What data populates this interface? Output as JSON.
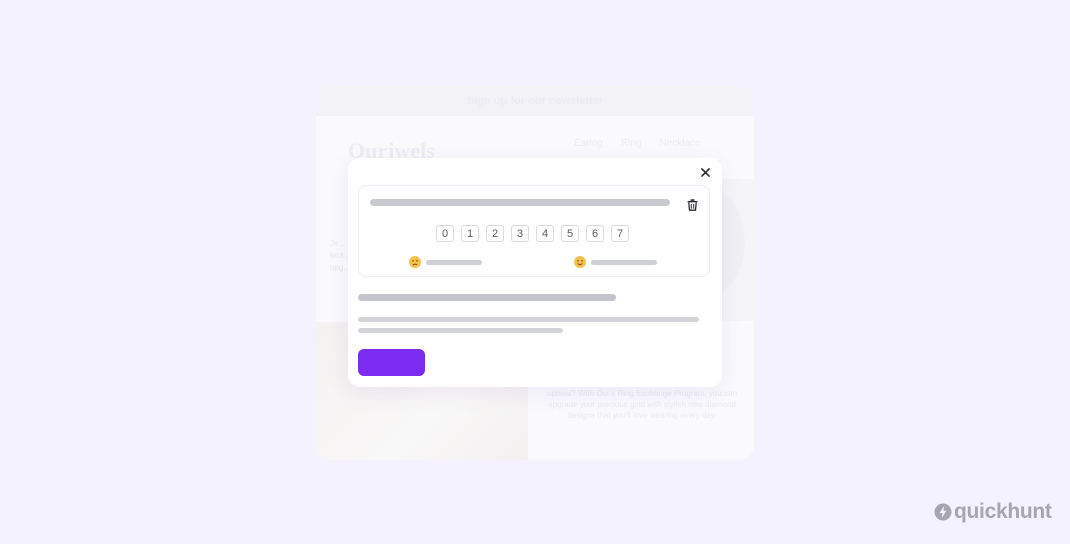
{
  "background_email": {
    "banner": "Sign up for our newsletter",
    "logo": "Ourjwels",
    "nav": [
      "Earing",
      "Ring",
      "Necklace"
    ],
    "side_text": "Je... lock... upg...",
    "copy": "upbeat? With Our's Ring Exchange Program, you can upgrade your precious gold with stylish new diamond designs that you'll love wearing every day."
  },
  "modal": {
    "close_icon": "close-icon",
    "question": {
      "trash_icon": "trash-icon",
      "scale": [
        "0",
        "1",
        "2",
        "3",
        "4",
        "5",
        "6",
        "7"
      ],
      "low_emoji": "sad-face-icon",
      "high_emoji": "happy-face-icon"
    },
    "colors": {
      "accent": "#7b2cf0",
      "page_background": "#f4f2fe"
    }
  },
  "brand": {
    "name": "quickhunt",
    "icon": "quickhunt-bolt-icon"
  }
}
